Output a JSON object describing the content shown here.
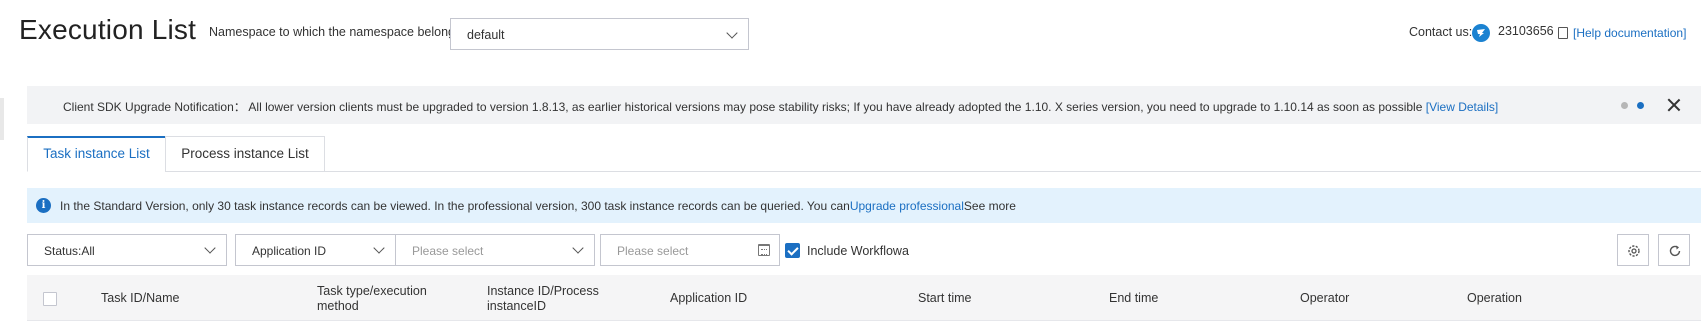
{
  "header": {
    "title": "Execution List",
    "namespace_label": "Namespace to which the namespace belongs:",
    "namespace_value": "default",
    "contact_label": "Contact us:",
    "contact_number": "23103656",
    "help_link": "[Help documentation]"
  },
  "notice": {
    "text": "Client SDK Upgrade Notification： All lower version clients must be upgraded to version 1.8.13, as earlier historical versions may pose stability risks; If you have already adopted the 1.10. X series version, you need to upgrade to 1.10.14 as soon as possible ",
    "link": "[View Details]"
  },
  "tabs": [
    {
      "label": "Task instance List",
      "active": true
    },
    {
      "label": "Process instance List",
      "active": false
    }
  ],
  "info": {
    "text": "In the Standard Version, only 30 task instance records can be viewed. In the professional version, 300 task instance records can be queried. You can",
    "link": "Upgrade professional",
    "suffix": "See more"
  },
  "filters": {
    "status": "Status:All",
    "field": "Application ID",
    "field_value_placeholder": "Please select",
    "date_placeholder": "Please select",
    "include_label": "Include Workflowa",
    "include_checked": true
  },
  "table": {
    "columns": [
      "Task ID/Name",
      "Task type/execution method",
      "Instance ID/Process instanceID",
      "Application ID",
      "Start time",
      "End time",
      "Operator",
      "Operation"
    ]
  },
  "colors": {
    "accent": "#1b6fc2",
    "info_bg": "#e3f2fd",
    "notice_bg": "#f2f3f5"
  },
  "icons": [
    "chevron-down-icon",
    "dingtalk-icon",
    "document-icon",
    "close-icon",
    "info-icon",
    "calendar-icon",
    "checkbox-icon",
    "settings-icon",
    "refresh-icon"
  ]
}
